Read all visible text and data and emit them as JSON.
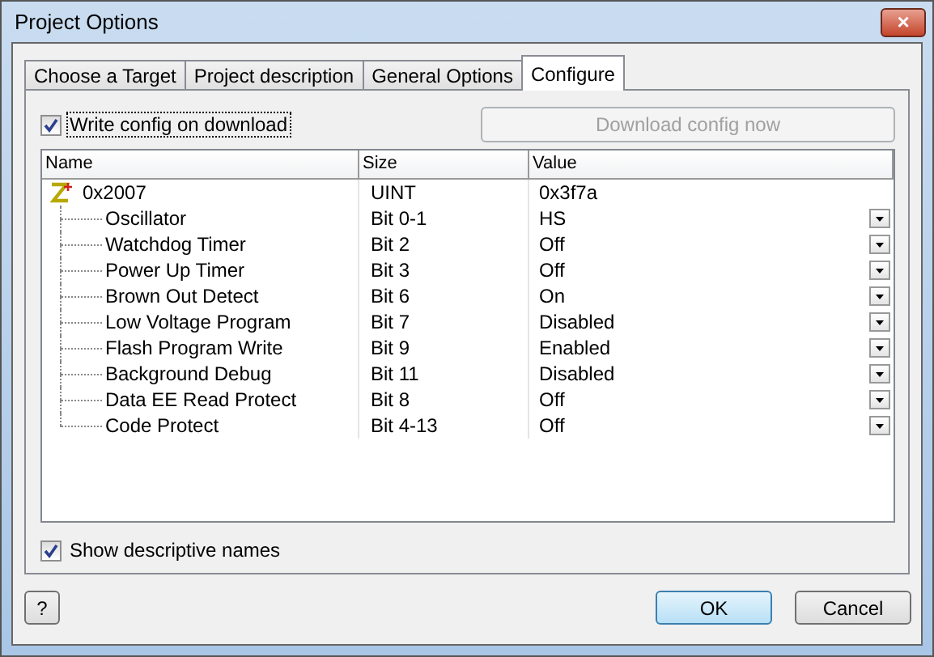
{
  "window": {
    "title": "Project Options",
    "close": "×"
  },
  "tabs": [
    {
      "label": "Choose a Target",
      "selected": false
    },
    {
      "label": "Project description",
      "selected": false
    },
    {
      "label": "General Options",
      "selected": false
    },
    {
      "label": "Configure",
      "selected": true
    }
  ],
  "write_config": {
    "label": "Write config on download",
    "checked": true
  },
  "download_button": {
    "label": "Download config now",
    "disabled": true
  },
  "table": {
    "columns": [
      "Name",
      "Size",
      "Value"
    ],
    "root": {
      "name": "0x2007",
      "size": "UINT",
      "value": "0x3f7a",
      "children": [
        {
          "name": "Oscillator",
          "size": "Bit 0-1",
          "value": "HS"
        },
        {
          "name": "Watchdog Timer",
          "size": "Bit 2",
          "value": "Off"
        },
        {
          "name": "Power Up Timer",
          "size": "Bit 3",
          "value": "Off"
        },
        {
          "name": "Brown Out Detect",
          "size": "Bit 6",
          "value": "On"
        },
        {
          "name": "Low Voltage Program",
          "size": "Bit 7",
          "value": "Disabled"
        },
        {
          "name": "Flash Program Write",
          "size": "Bit 9",
          "value": "Enabled"
        },
        {
          "name": "Background Debug",
          "size": "Bit 11",
          "value": "Disabled"
        },
        {
          "name": "Data EE Read Protect",
          "size": "Bit 8",
          "value": "Off"
        },
        {
          "name": "Code Protect",
          "size": "Bit 4-13",
          "value": "Off"
        }
      ]
    }
  },
  "show_names": {
    "label": "Show descriptive names",
    "checked": true
  },
  "help_button": "?",
  "buttons": [
    {
      "label": "OK",
      "default": true
    },
    {
      "label": "Cancel",
      "default": false
    }
  ]
}
